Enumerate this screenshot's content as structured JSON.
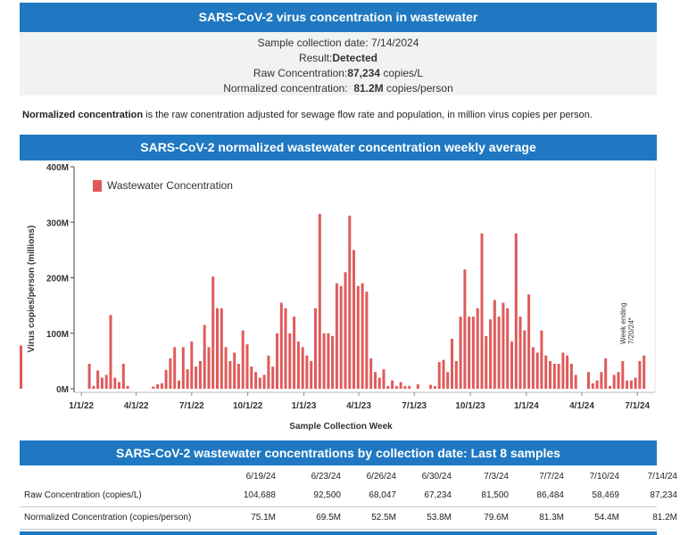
{
  "header": {
    "title": "SARS-CoV-2 virus concentration in wastewater"
  },
  "sample": {
    "date_label": "Sample collection date:",
    "date_value": "7/14/2024",
    "result_label": "Result:",
    "result_value": "Detected",
    "raw_label": "Raw Concentration:",
    "raw_value": "87,234",
    "raw_unit": "copies/L",
    "norm_label": "Normalized concentration:",
    "norm_value": "81.2M",
    "norm_unit": "copies/person"
  },
  "note": {
    "bold": "Normalized concentration",
    "text": " is the raw conentration adjusted for sewage flow rate and population, in million virus copies per person."
  },
  "chart_title": "SARS-CoV-2 normalized wastewater concentration weekly average",
  "chart_data": {
    "type": "bar",
    "title": "SARS-CoV-2 normalized wastewater concentration weekly average",
    "xlabel": "Sample Collection Week",
    "ylabel": "Virus copies/person (millions)",
    "ylim": [
      0,
      400
    ],
    "yticks": [
      0,
      100,
      200,
      300,
      400
    ],
    "ytick_labels": [
      "0M",
      "100M",
      "200M",
      "300M",
      "400M"
    ],
    "xtick_labels": [
      "1/1/22",
      "4/1/22",
      "7/1/22",
      "10/1/22",
      "1/1/23",
      "4/1/23",
      "7/1/23",
      "10/1/23",
      "1/1/24",
      "4/1/24",
      "7/1/24"
    ],
    "xtick_dates": [
      "2022-01-01",
      "2022-04-01",
      "2022-07-01",
      "2022-10-01",
      "2023-01-01",
      "2023-04-01",
      "2023-07-01",
      "2023-10-01",
      "2024-01-01",
      "2024-04-01",
      "2024-07-01"
    ],
    "xlim": [
      "2021-12-20",
      "2024-07-30"
    ],
    "legend": {
      "label": "Wastewater Concentration",
      "position": "top-left"
    },
    "annotation": "Week ending 7/20/24*",
    "bar_color": "#e05a5a",
    "series": [
      {
        "name": "Wastewater Concentration",
        "dates": [
          "2022-01-14",
          "2022-01-21",
          "2022-01-28",
          "2022-02-04",
          "2022-02-11",
          "2022-02-18",
          "2022-02-25",
          "2022-03-04",
          "2022-03-11",
          "2022-03-18",
          "2022-04-29",
          "2022-05-06",
          "2022-05-13",
          "2022-05-20",
          "2022-05-27",
          "2022-06-03",
          "2022-06-10",
          "2022-06-17",
          "2022-06-24",
          "2022-07-01",
          "2022-07-08",
          "2022-07-15",
          "2022-07-22",
          "2022-07-29",
          "2022-08-05",
          "2022-08-12",
          "2022-08-19",
          "2022-08-26",
          "2022-09-02",
          "2022-09-09",
          "2022-09-16",
          "2022-09-23",
          "2022-09-30",
          "2022-10-07",
          "2022-10-14",
          "2022-10-21",
          "2022-10-28",
          "2022-11-04",
          "2022-11-11",
          "2022-11-18",
          "2022-11-25",
          "2022-12-02",
          "2022-12-09",
          "2022-12-16",
          "2022-12-23",
          "2022-12-30",
          "2023-01-06",
          "2023-01-13",
          "2023-01-20",
          "2023-01-27",
          "2023-02-03",
          "2023-02-10",
          "2023-02-17",
          "2023-02-24",
          "2023-03-03",
          "2023-03-10",
          "2023-03-17",
          "2023-03-24",
          "2023-03-31",
          "2023-04-07",
          "2023-04-14",
          "2023-04-21",
          "2023-04-28",
          "2023-05-05",
          "2023-05-12",
          "2023-05-19",
          "2023-05-26",
          "2023-06-02",
          "2023-06-09",
          "2023-06-16",
          "2023-06-23",
          "2023-07-07",
          "2023-07-28",
          "2023-08-04",
          "2023-08-11",
          "2023-08-18",
          "2023-08-25",
          "2023-09-01",
          "2023-09-08",
          "2023-09-15",
          "2023-09-22",
          "2023-09-29",
          "2023-10-06",
          "2023-10-13",
          "2023-10-20",
          "2023-10-27",
          "2023-11-03",
          "2023-11-10",
          "2023-11-17",
          "2023-11-24",
          "2023-12-01",
          "2023-12-08",
          "2023-12-15",
          "2023-12-22",
          "2023-12-29",
          "2024-01-05",
          "2024-01-12",
          "2024-01-19",
          "2024-01-26",
          "2024-02-02",
          "2024-02-09",
          "2024-02-16",
          "2024-02-23",
          "2024-03-01",
          "2024-03-08",
          "2024-03-15",
          "2024-03-22",
          "2024-04-12",
          "2024-04-19",
          "2024-04-26",
          "2024-05-03",
          "2024-05-10",
          "2024-05-17",
          "2024-05-24",
          "2024-05-31",
          "2024-06-07",
          "2024-06-14",
          "2024-06-21",
          "2024-06-28",
          "2024-07-05",
          "2024-07-12"
        ],
        "values": [
          45,
          5,
          33,
          20,
          25,
          133,
          20,
          12,
          45,
          5,
          4,
          8,
          10,
          34,
          55,
          75,
          15,
          75,
          35,
          85,
          40,
          50,
          115,
          75,
          202,
          145,
          145,
          75,
          50,
          65,
          45,
          105,
          80,
          40,
          30,
          20,
          25,
          60,
          40,
          100,
          155,
          145,
          100,
          130,
          85,
          75,
          60,
          50,
          145,
          315,
          100,
          100,
          95,
          190,
          185,
          210,
          312,
          250,
          185,
          190,
          175,
          55,
          30,
          20,
          35,
          5,
          15,
          5,
          12,
          5,
          5,
          8,
          7,
          5,
          48,
          52,
          30,
          90,
          50,
          130,
          215,
          130,
          130,
          145,
          280,
          95,
          125,
          160,
          130,
          155,
          145,
          85,
          280,
          130,
          105,
          170,
          75,
          65,
          105,
          60,
          50,
          45,
          45,
          65,
          60,
          45,
          25,
          30,
          10,
          15,
          30,
          55,
          5,
          25,
          30,
          50,
          15,
          15,
          20,
          50,
          60,
          65,
          78
        ]
      }
    ]
  },
  "table": {
    "title": "SARS-CoV-2 wastewater concentrations by collection date: Last 8 samples",
    "dates": [
      "6/19/24",
      "6/23/24",
      "6/26/24",
      "6/30/24",
      "7/3/24",
      "7/7/24",
      "7/10/24",
      "7/14/24"
    ],
    "rows": [
      {
        "label": "Raw Concentration (copies/L)",
        "values": [
          "104,688",
          "92,500",
          "68,047",
          "67,234",
          "81,500",
          "86,484",
          "58,469",
          "87,234"
        ]
      },
      {
        "label": "Normalized Concentration (copies/person)",
        "values": [
          "75.1M",
          "69.5M",
          "52.5M",
          "53.8M",
          "79.6M",
          "81.3M",
          "54.4M",
          "81.2M"
        ]
      }
    ]
  }
}
